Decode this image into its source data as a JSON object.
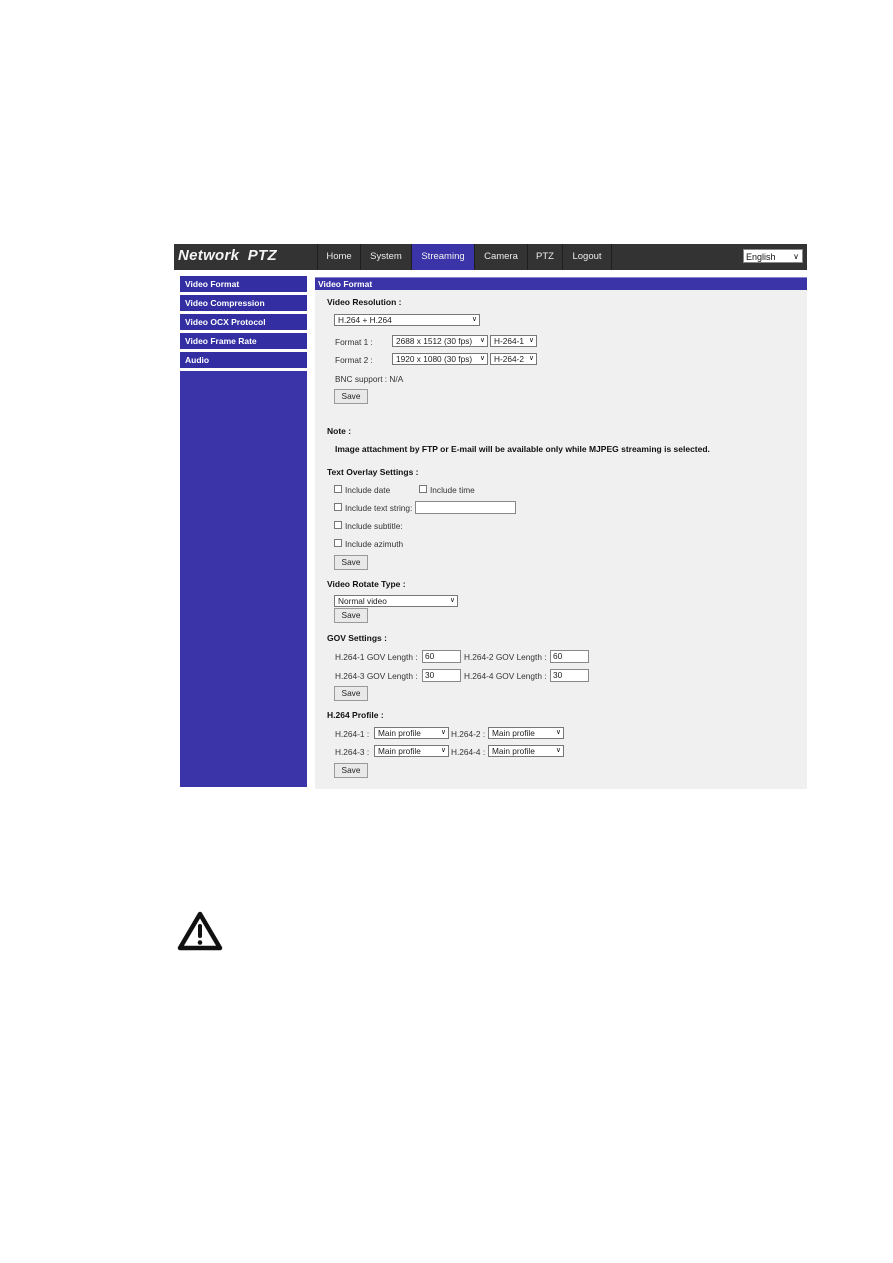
{
  "header": {
    "brand": "Network PTZ",
    "tabs": [
      {
        "label": "Home",
        "active": false
      },
      {
        "label": "System",
        "active": false
      },
      {
        "label": "Streaming",
        "active": true
      },
      {
        "label": "Camera",
        "active": false
      },
      {
        "label": "PTZ",
        "active": false
      },
      {
        "label": "Logout",
        "active": false
      }
    ],
    "language": "English"
  },
  "sidebar": {
    "items": [
      {
        "label": "Video Format"
      },
      {
        "label": "Video Compression"
      },
      {
        "label": "Video OCX Protocol"
      },
      {
        "label": "Video Frame Rate"
      },
      {
        "label": "Audio"
      }
    ]
  },
  "content": {
    "title": "Video Format",
    "video_resolution": {
      "heading": "Video Resolution :",
      "mode": "H.264 + H.264",
      "format1_label": "Format 1 :",
      "format1_resolution": "2688 x 1512 (30 fps)",
      "format1_stream": "H-264-1",
      "format2_label": "Format 2 :",
      "format2_resolution": "1920 x 1080 (30 fps)",
      "format2_stream": "H-264-2",
      "bnc_support": "BNC support : N/A",
      "save": "Save"
    },
    "note": {
      "heading": "Note :",
      "text": "Image attachment by FTP or E-mail will be available only while MJPEG streaming is selected."
    },
    "text_overlay": {
      "heading": "Text Overlay Settings :",
      "include_date": "Include date",
      "include_time": "Include time",
      "include_text_string": "Include text string:",
      "text_string_value": "",
      "include_subtitle": "Include subtitle:",
      "include_azimuth": "Include azimuth",
      "save": "Save"
    },
    "rotate": {
      "heading": "Video Rotate Type :",
      "value": "Normal video",
      "save": "Save"
    },
    "gov": {
      "heading": "GOV Settings :",
      "h1_label": "H.264-1 GOV Length :",
      "h1_value": "60",
      "h2_label": "H.264-2 GOV Length :",
      "h2_value": "60",
      "h3_label": "H.264-3 GOV Length :",
      "h3_value": "30",
      "h4_label": "H.264-4 GOV Length :",
      "h4_value": "30",
      "save": "Save"
    },
    "profile": {
      "heading": "H.264 Profile :",
      "h1_label": "H.264-1 :",
      "h1_value": "Main profile",
      "h2_label": "H.264-2 :",
      "h2_value": "Main profile",
      "h3_label": "H.264-3 :",
      "h3_value": "Main profile",
      "h4_label": "H.264-4 :",
      "h4_value": "Main profile",
      "save": "Save"
    }
  },
  "icons": {
    "warning": "warning-triangle-icon"
  },
  "colors": {
    "topbar": "#333333",
    "accent": "#3a34a8",
    "panel": "#f0f0f0"
  }
}
